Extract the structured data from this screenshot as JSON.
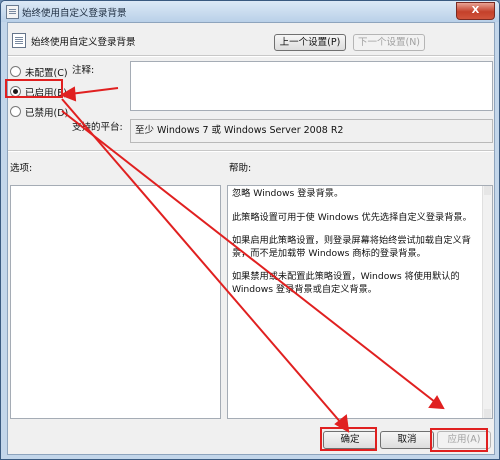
{
  "window": {
    "title": "始终使用自定义登录背景",
    "close_label": "X"
  },
  "header": {
    "title": "始终使用自定义登录背景",
    "prev_label": "上一个设置(P)",
    "next_label": "下一个设置(N)"
  },
  "state": {
    "options": [
      {
        "label": "未配置(C)",
        "selected": false
      },
      {
        "label": "已启用(E)",
        "selected": true
      },
      {
        "label": "已禁用(D)",
        "selected": false
      }
    ]
  },
  "comment": {
    "label": "注释:",
    "value": ""
  },
  "platform": {
    "label": "支持的平台:",
    "value": "至少 Windows 7 或 Windows Server 2008 R2"
  },
  "options_panel": {
    "label": "选项:"
  },
  "help_panel": {
    "label": "帮助:",
    "paragraphs": [
      "忽略 Windows 登录背景。",
      "此策略设置可用于使 Windows 优先选择自定义登录背景。",
      "如果启用此策略设置，则登录屏幕将始终尝试加载自定义背景，而不是加载带 Windows 商标的登录背景。",
      "如果禁用或未配置此策略设置，Windows 将使用默认的 Windows 登录背景或自定义背景。"
    ]
  },
  "footer": {
    "ok_label": "确定",
    "cancel_label": "取消",
    "apply_label": "应用(A)"
  },
  "annotation_color": "#e02020"
}
